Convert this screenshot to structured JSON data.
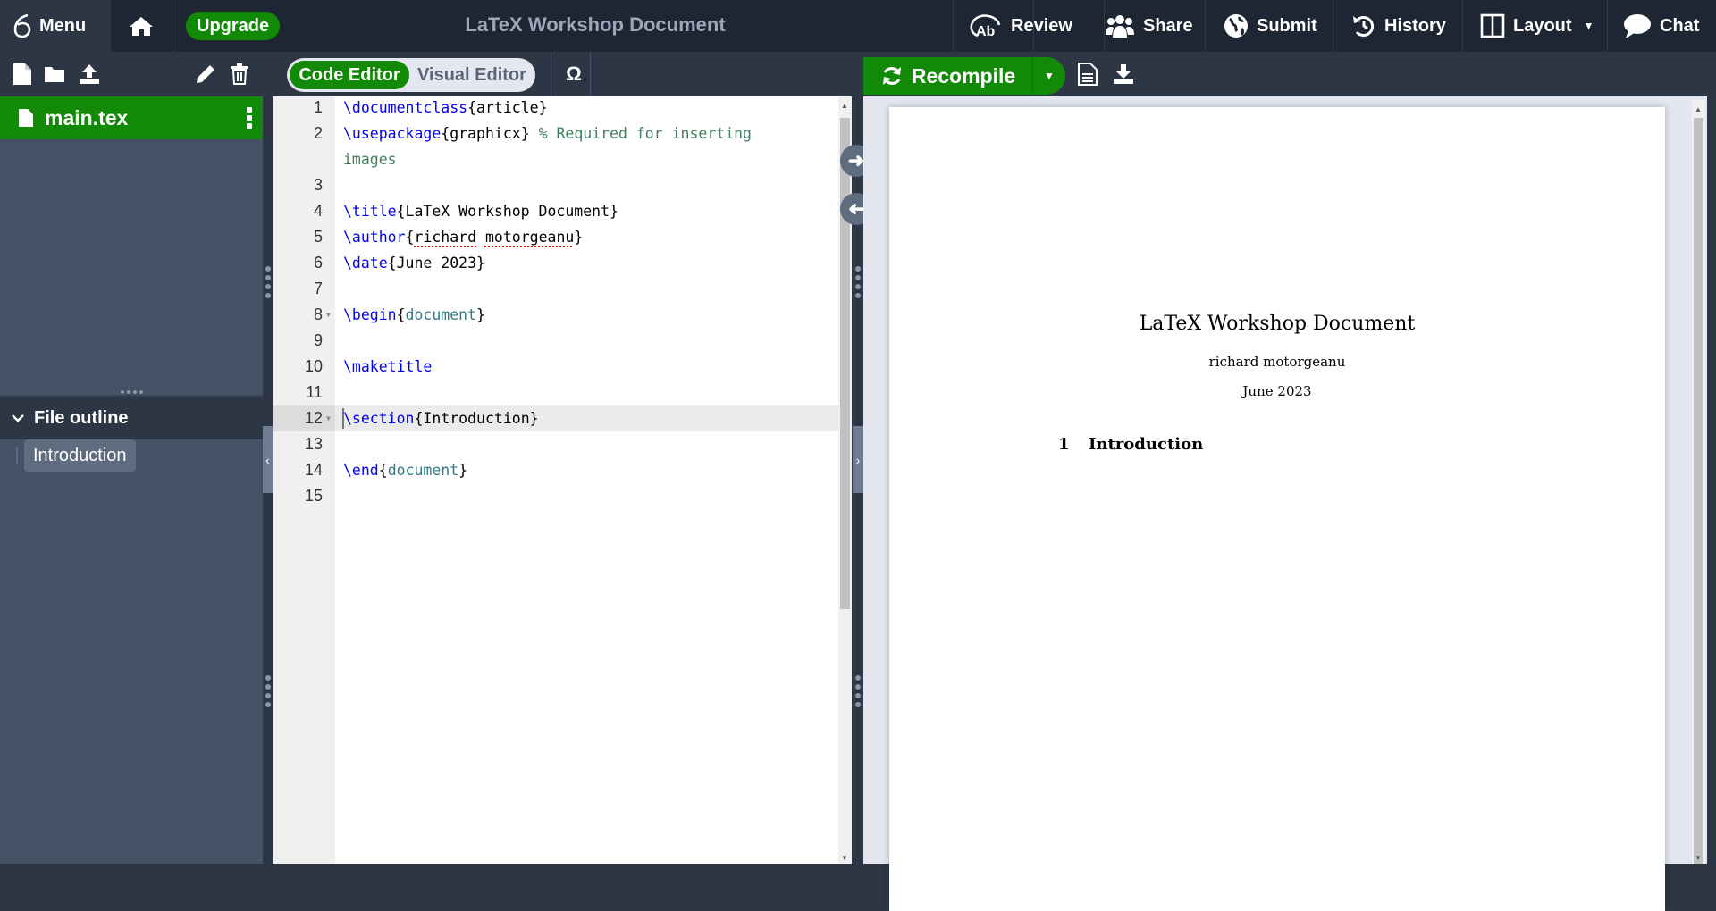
{
  "topbar": {
    "menu_label": "Menu",
    "upgrade_label": "Upgrade",
    "title": "LaTeX Workshop Document",
    "actions": [
      {
        "label": "Review",
        "icon": "review-icon"
      },
      {
        "label": "Share",
        "icon": "share-icon"
      },
      {
        "label": "Submit",
        "icon": "submit-icon"
      },
      {
        "label": "History",
        "icon": "history-icon"
      },
      {
        "label": "Layout",
        "icon": "layout-icon"
      },
      {
        "label": "Chat",
        "icon": "chat-icon"
      }
    ]
  },
  "editor_toolbar": {
    "code_editor_label": "Code Editor",
    "visual_editor_label": "Visual Editor",
    "symbol_label": "Ω",
    "active_mode": "Code Editor"
  },
  "pdf_toolbar": {
    "recompile_label": "Recompile"
  },
  "file_tree": {
    "files": [
      {
        "name": "main.tex",
        "selected": true
      }
    ]
  },
  "outline": {
    "title": "File outline",
    "items": [
      "Introduction"
    ]
  },
  "editor": {
    "active_line": 12,
    "lines": [
      {
        "n": "1",
        "cmd": "\\documentclass",
        "arg": "article",
        "arg_type": "plain"
      },
      {
        "n": "2",
        "cmd": "\\usepackage",
        "arg": "graphicx",
        "arg_type": "plain",
        "comment": "% Required for inserting"
      },
      {
        "n": "",
        "comment": "images"
      },
      {
        "n": "3"
      },
      {
        "n": "4",
        "cmd": "\\title",
        "arg": "LaTeX Workshop Document",
        "arg_type": "plain"
      },
      {
        "n": "5",
        "cmd": "\\author",
        "arg": "richard motorgeanu",
        "arg_type": "spell"
      },
      {
        "n": "6",
        "cmd": "\\date",
        "arg": "June 2023",
        "arg_type": "plain"
      },
      {
        "n": "7"
      },
      {
        "n": "8",
        "cmd": "\\begin",
        "arg": "document",
        "arg_type": "env",
        "fold": true
      },
      {
        "n": "9"
      },
      {
        "n": "10",
        "cmd": "\\maketitle"
      },
      {
        "n": "11"
      },
      {
        "n": "12",
        "cmd": "\\section",
        "arg": "Introduction",
        "arg_type": "plain",
        "fold": true
      },
      {
        "n": "13"
      },
      {
        "n": "14",
        "cmd": "\\end",
        "arg": "document",
        "arg_type": "env"
      },
      {
        "n": "15"
      }
    ]
  },
  "pdf": {
    "title": "LaTeX Workshop Document",
    "author": "richard motorgeanu",
    "date": "June 2023",
    "section_number": "1",
    "section_title": "Introduction"
  }
}
